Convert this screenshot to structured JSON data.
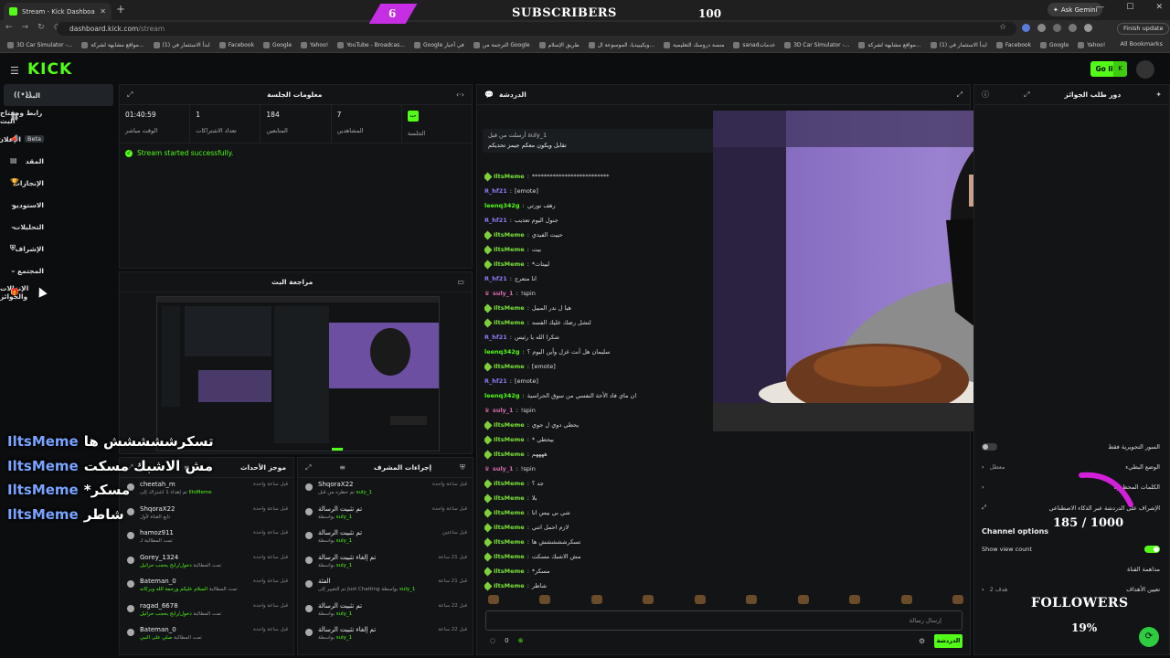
{
  "browser": {
    "tab_title": "Stream - Kick Dashboard",
    "url_host": "dashboard.kick.com",
    "url_path": "/stream",
    "ask_gemini": "Ask Gemini",
    "finish_update": "Finish update",
    "all_bookmarks": "All Bookmarks",
    "bookmarks": [
      "3D Car Simulator -...",
      "مواقع مشابهة لشركة...",
      "(1) ابدأ الاستثمار في",
      "Facebook",
      "Google",
      "Yahoo!",
      "YouTube - Broadcas...",
      "Google في أخبار",
      "الترجمة من Google",
      "طريق الإسلام",
      "ويكيبيديا، الموسوعة ال...",
      "منصة دروسك التعليمية",
      "sanadخدمات",
      "3D Car Simulator -...",
      "مواقع مشابهة لشركة...",
      "(1) ابدأ الاستثمار في",
      "Facebook",
      "Google",
      "Yahoo!"
    ]
  },
  "overlay": {
    "subscribers_current": "6",
    "subscribers_label": "SUBSCRIBERS",
    "subscribers_goal": "100",
    "followers_count": "185 / 1000",
    "followers_label": "FOLLOWERS",
    "followers_percent": "19%",
    "chat": [
      {
        "user": "IltsMeme",
        "msg": "تسكرششششش ها"
      },
      {
        "user": "IltsMeme",
        "msg": "مش الاشبك مسكت"
      },
      {
        "user": "IltsMeme",
        "msg": "*مسكر"
      },
      {
        "user": "IltsMeme",
        "msg": "شاطر"
      }
    ]
  },
  "header": {
    "logo": "KICK",
    "go_live": "Go live"
  },
  "sidebar": {
    "items": [
      {
        "label": "البث",
        "icon": "broadcast-icon"
      },
      {
        "label": "رابط ومفتاح البث",
        "icon": "link-icon"
      },
      {
        "label": "الإعلان",
        "badge": "Beta",
        "icon": "megaphone-icon"
      },
      {
        "label": "المقد",
        "icon": "wallet-icon"
      },
      {
        "label": "الإنجازات",
        "icon": "trophy-icon"
      },
      {
        "label": "الاستوديو",
        "icon": "studio-icon"
      },
      {
        "label": "التحليلات",
        "icon": "analytics-icon"
      },
      {
        "label": "الإشراف",
        "icon": "shield-icon"
      },
      {
        "label": "المجتمع",
        "icon": "community-icon"
      },
      {
        "label": "الإنزالات والجوائز",
        "icon": "gift-icon"
      }
    ]
  },
  "session": {
    "title": "معلومات الجلسة",
    "health_label": "الجلسة",
    "health_badge": "جيد",
    "stats": [
      {
        "value": "7",
        "label": "المشاهدين"
      },
      {
        "value": "184",
        "label": "المتابعين"
      },
      {
        "value": "1",
        "label": "تعداد الاشتراكات"
      },
      {
        "value": "01:40:59",
        "label": "الوقت مباشر"
      }
    ],
    "success": "Stream started successfully."
  },
  "preview": {
    "title": "مراجعة البث",
    "followers_mini": "FOLLOWERS"
  },
  "events": {
    "title": "موجز الأحداث",
    "rows": [
      {
        "name": "cheetah_m",
        "desc": "تم إهداء 1 اشتراك إلى",
        "highlight": "IltsMeme",
        "time": "قبل ساعة واحدة"
      },
      {
        "name": "ShqoraX22",
        "desc": "تابع القناة لأول",
        "highlight": "",
        "time": "قبل ساعة واحدة"
      },
      {
        "name": "hamoz911",
        "desc": "تمت المطالبة لـ",
        "highlight": "",
        "time": "قبل ساعة واحدة"
      },
      {
        "name": "Gorey_1324",
        "desc": "تمت المطالبة",
        "highlight": "دخول/رابح بحجب حراتيل",
        "time": "قبل ساعة واحدة"
      },
      {
        "name": "Bateman_0",
        "desc": "تمت المطالبة",
        "highlight": "السلام عليكم ورحمة الله وبركاته",
        "time": "قبل ساعة واحدة"
      },
      {
        "name": "ragad_6678",
        "desc": "تمت المطالبة",
        "highlight": "دخول/رابح بحجب حراتيل",
        "time": "قبل ساعة واحدة"
      },
      {
        "name": "Bateman_0",
        "desc": "تمت المطالبة",
        "highlight": "صلي على النبي",
        "time": "قبل ساعة واحدة"
      }
    ]
  },
  "modactions": {
    "title": "إجراءات المشرف",
    "rows": [
      {
        "name": "ShqoraX22",
        "desc": "تم حظره من قبل",
        "highlight": "suly_1",
        "time": "قبل ساعة واحدة"
      },
      {
        "name": "تم تثبيت الرسالة",
        "desc": "بواسطة",
        "highlight": "suly_1",
        "time": "قبل ساعة واحدة"
      },
      {
        "name": "تم تثبيت الرسالة",
        "desc": "بواسطة",
        "highlight": "suly_1",
        "time": "قبل ساعتين"
      },
      {
        "name": "تم إلغاء تثبيت الرسالة",
        "desc": "بواسطة",
        "highlight": "suly_1",
        "time": "قبل 21 ساعة"
      },
      {
        "name": "الفئة",
        "desc": "تم التغيير إلى Just Chatting بواسطة",
        "highlight": "suly_1",
        "time": "قبل 21 ساعة"
      },
      {
        "name": "تم تثبيت الرسالة",
        "desc": "بواسطة",
        "highlight": "suly_1",
        "time": "قبل 22 ساعة"
      },
      {
        "name": "تم إلغاء تثبيت الرسالة",
        "desc": "بواسطة",
        "highlight": "suly_1",
        "time": "قبل 22 ساعة"
      }
    ]
  },
  "chat": {
    "title": "الدردشة",
    "pinned_by": "أرسلت من قبل suly_1",
    "pinned_msg": "تقابل ويكون معكم جيمز تحديكم",
    "lines": [
      {
        "user": "IltsMeme",
        "color": "green",
        "text": "**************************"
      },
      {
        "user": "R_hf21",
        "color": "blue",
        "text": "[emote]"
      },
      {
        "user": "leenq342g",
        "color": "lime",
        "text": "رهف نورتي"
      },
      {
        "user": "R_hf21",
        "color": "blue",
        "text": "جنول اليوم تعذيب"
      },
      {
        "user": "IltsMeme",
        "color": "green",
        "text": "حبيت الفيدي"
      },
      {
        "user": "IltsMeme",
        "color": "green",
        "text": "بيت"
      },
      {
        "user": "IltsMeme",
        "color": "green",
        "text": "*لييتات"
      },
      {
        "user": "R_hf21",
        "color": "blue",
        "text": "انا متعرج"
      },
      {
        "user": "suly_1",
        "color": "pink",
        "text": "!spin"
      },
      {
        "user": "IltsMeme",
        "color": "green",
        "text": "هيا ل ندر المبيل"
      },
      {
        "user": "IltsMeme",
        "color": "green",
        "text": "لتشل رضك عليك الفسه"
      },
      {
        "user": "R_hf21",
        "color": "blue",
        "text": "شكرا الله يا رئيس"
      },
      {
        "user": "leenq342g",
        "color": "lime",
        "text": "سليمان هل أنت غزل وأين اليوم ؟"
      },
      {
        "user": "IltsMeme",
        "color": "green",
        "text": "[emote]"
      },
      {
        "user": "R_hf21",
        "color": "blue",
        "text": "[emote]"
      },
      {
        "user": "leenq342g",
        "color": "lime",
        "text": "ان ماي فاد الأخة النفسي من سوق الحراسية"
      },
      {
        "user": "suly_1",
        "color": "pink",
        "text": "!spin"
      },
      {
        "user": "IltsMeme",
        "color": "green",
        "text": "يحطي دوي ل جوي"
      },
      {
        "user": "IltsMeme",
        "color": "green",
        "text": "* بيحطي"
      },
      {
        "user": "IltsMeme",
        "color": "green",
        "text": "ههههم"
      },
      {
        "user": "suly_1",
        "color": "pink",
        "text": "!spin"
      },
      {
        "user": "IltsMeme",
        "color": "green",
        "text": "جد ؟"
      },
      {
        "user": "IltsMeme",
        "color": "green",
        "text": "بلا"
      },
      {
        "user": "IltsMeme",
        "color": "green",
        "text": "شي بي بيس انا"
      },
      {
        "user": "IltsMeme",
        "color": "green",
        "text": "لازم احمل اتني"
      },
      {
        "user": "IltsMeme",
        "color": "green",
        "text": "تسكرششششش ها"
      },
      {
        "user": "IltsMeme",
        "color": "green",
        "text": "مش الاشبك مسكت"
      },
      {
        "user": "IltsMeme",
        "color": "green",
        "text": "*مسكر"
      },
      {
        "user": "IltsMeme",
        "color": "green",
        "text": "شاطر"
      }
    ],
    "input_placeholder": "إرسال رسالة",
    "viewers_count": "0",
    "send_label": "الدردشة"
  },
  "rewards": {
    "title": "دور طلب الجوائز",
    "options": [
      {
        "label": "السور التجويرية فقط",
        "type": "toggle",
        "on": false
      },
      {
        "label": "الوضع البطيء",
        "type": "link",
        "value": "معطل"
      },
      {
        "label": "الكلمات المحظورة",
        "type": "link",
        "value": ""
      },
      {
        "label": "الإشراف على الدردشة عبر الذكاء الاصطناعي",
        "type": "link",
        "value": ""
      }
    ],
    "channel_options_title": "Channel options",
    "show_view_count": "Show view count",
    "show_view_count_on": true,
    "channel_review": "مداهمة القناة",
    "goals": "تعيين الأهداف",
    "goals_value": "هدف 2"
  },
  "colors": {
    "accent": "#53fc18",
    "background": "#0b0d0e",
    "panel": "#121416",
    "overlay_magenta": "#c62ee3"
  }
}
